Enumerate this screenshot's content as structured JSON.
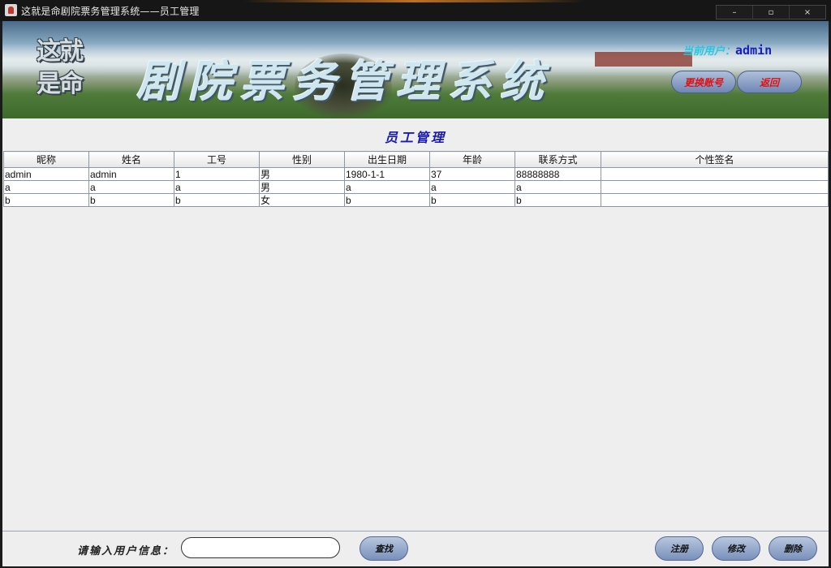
{
  "window": {
    "title": "这就是命剧院票务管理系统——员工管理",
    "controls": {
      "minimize": "–",
      "maximize": "▫",
      "close": "×"
    }
  },
  "banner": {
    "logo_line1": "这就",
    "logo_line2": "是命",
    "system_title": "剧院票务管理系统",
    "current_user_label": "当前用户：",
    "current_user_value": "admin",
    "switch_account": "更换账号",
    "back": "返回"
  },
  "page_title": "员工管理",
  "table": {
    "columns": [
      "昵称",
      "姓名",
      "工号",
      "性别",
      "出生日期",
      "年龄",
      "联系方式",
      "个性签名"
    ],
    "rows": [
      [
        "admin",
        "admin",
        "1",
        "男",
        "1980-1-1",
        "37",
        "88888888",
        ""
      ],
      [
        "a",
        "a",
        "a",
        "男",
        "a",
        "a",
        "a",
        ""
      ],
      [
        "b",
        "b",
        "b",
        "女",
        "b",
        "b",
        "b",
        ""
      ]
    ]
  },
  "bottom": {
    "search_label": "请输入用户信息：",
    "search_value": "",
    "search_placeholder": "",
    "find": "查找",
    "register": "注册",
    "modify": "修改",
    "delete": "删除"
  }
}
